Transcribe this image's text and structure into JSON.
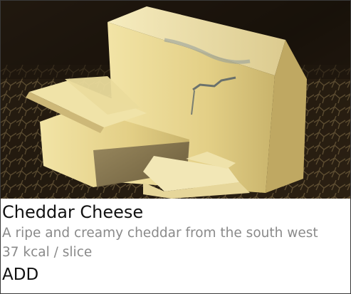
{
  "product": {
    "title": "Cheddar Cheese",
    "description": "A ripe and creamy cheddar from the south west",
    "nutrition": "37 kcal / slice",
    "add_label": "ADD",
    "image_subject": "cheddar-cheese-photo"
  },
  "colors": {
    "title_text": "#111111",
    "secondary_text": "#8a8a8a",
    "card_border": "#3a3a3a",
    "cheese": "#e8d48c"
  }
}
